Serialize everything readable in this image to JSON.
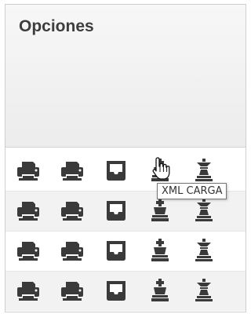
{
  "panel": {
    "title": "Opciones"
  },
  "rows": [
    {
      "icons": [
        "printer-icon",
        "printer-icon",
        "inbox-icon",
        "chess-king-icon",
        "chess-rook-icon"
      ]
    },
    {
      "icons": [
        "printer-icon",
        "printer-icon",
        "inbox-icon",
        "chess-king-icon",
        "chess-rook-icon"
      ]
    },
    {
      "icons": [
        "printer-icon",
        "printer-icon",
        "inbox-icon",
        "chess-king-icon",
        "chess-rook-icon"
      ]
    },
    {
      "icons": [
        "printer-icon",
        "printer-icon",
        "inbox-icon",
        "chess-king-icon",
        "chess-rook-icon"
      ]
    }
  ],
  "tooltip": {
    "text": "XML CARGA"
  },
  "colors": {
    "icon": "#3a3a3a",
    "title": "#3d3d3d",
    "alt_row": "#f2f2f2"
  }
}
